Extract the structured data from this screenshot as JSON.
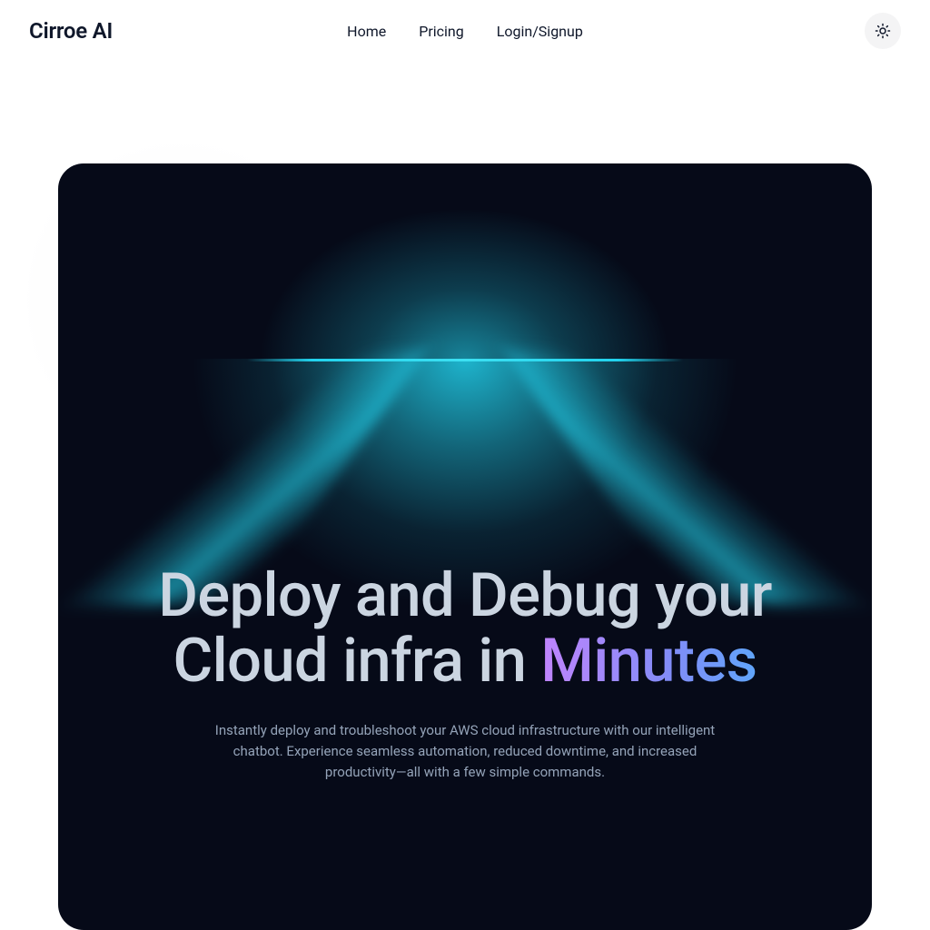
{
  "header": {
    "logo": "Cirroe AI",
    "nav": {
      "home": "Home",
      "pricing": "Pricing",
      "login": "Login/Signup"
    }
  },
  "hero": {
    "title_line1": "Deploy and Debug your",
    "title_line2_prefix": "Cloud infra in ",
    "title_line2_accent": "Minutes",
    "subtitle": "Instantly deploy and troubleshoot your AWS cloud infrastructure with our intelligent chatbot. Experience seamless automation, reduced downtime, and increased productivity—all with a few simple commands."
  }
}
